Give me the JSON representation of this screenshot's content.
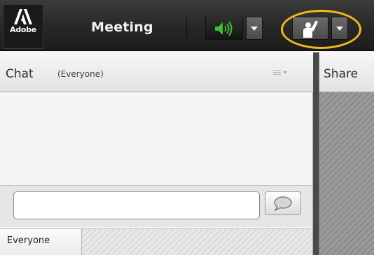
{
  "toolbar": {
    "logo_text": "Adobe",
    "meeting_menu": "Meeting",
    "speaker_icon": "speaker-icon",
    "status_icon": "raise-hand-icon",
    "speaker_color": "#3fc02f",
    "highlight_color": "#f1b81b"
  },
  "chat": {
    "title": "Chat",
    "audience": "(Everyone)",
    "input_value": "",
    "send_icon": "speech-bubble-icon",
    "tabs": [
      {
        "label": "Everyone"
      }
    ]
  },
  "share": {
    "title": "Share"
  }
}
